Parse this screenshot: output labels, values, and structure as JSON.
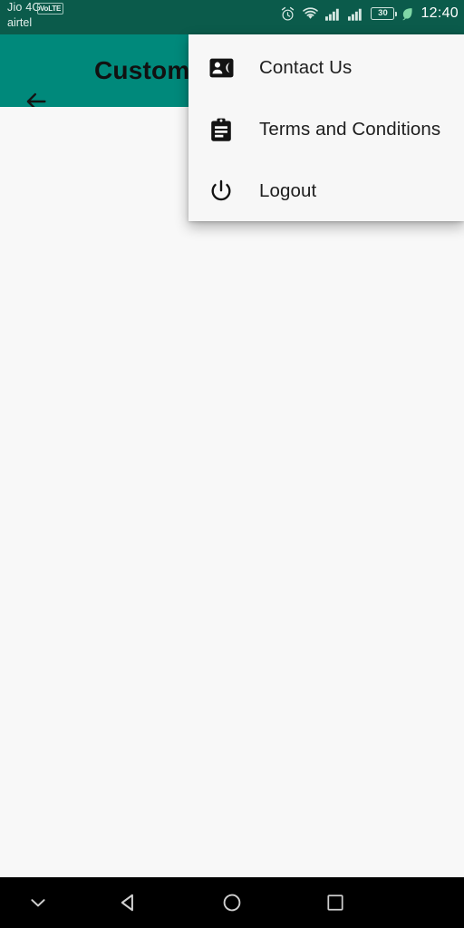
{
  "status_bar": {
    "carrier_primary": "Jio 4G",
    "volte_badge": "VoLTE",
    "carrier_secondary": "airtel",
    "battery_level": "30",
    "time": "12:40",
    "icons": {
      "alarm": "alarm-clock-icon",
      "wifi": "wifi-icon",
      "signal_sim1": "signal-bars-icon",
      "signal_sim2": "signal-bars-icon",
      "battery": "battery-icon",
      "eco": "leaf-power-saving-icon"
    },
    "background_color": "#0b5b4b"
  },
  "app_bar": {
    "title": "Custom",
    "back_icon": "arrow-left-icon",
    "background_color": "#00897b",
    "title_color": "#111111"
  },
  "overflow_menu": {
    "background_color": "#f7f7f7",
    "items": [
      {
        "label": "Contact Us",
        "icon": "contact-phone-icon"
      },
      {
        "label": "Terms and Conditions",
        "icon": "clipboard-assignment-icon"
      },
      {
        "label": "Logout",
        "icon": "power-icon"
      }
    ]
  },
  "content": {
    "background_color": "#f8f8f8"
  },
  "nav_bar": {
    "background_color": "#000000",
    "buttons": [
      {
        "name": "hide-navbar",
        "icon": "chevron-down-icon"
      },
      {
        "name": "back",
        "icon": "triangle-left-icon"
      },
      {
        "name": "home",
        "icon": "circle-icon"
      },
      {
        "name": "recents",
        "icon": "square-icon"
      }
    ]
  }
}
